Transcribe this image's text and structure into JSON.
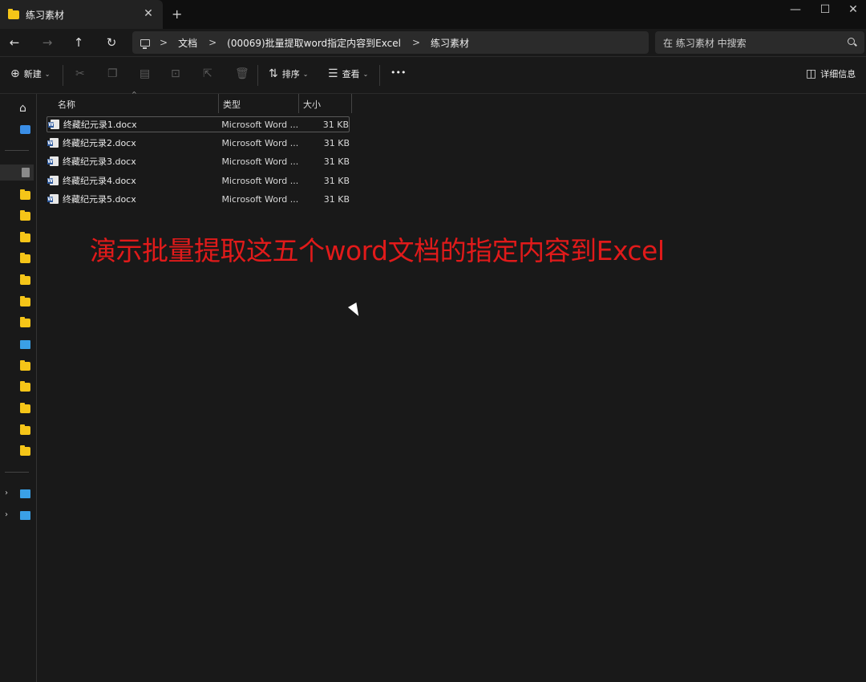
{
  "window": {
    "tab_title": "练习素材",
    "close_tab": "✕",
    "new_tab": "+",
    "minimize": "—",
    "maximize": "☐",
    "close": "✕"
  },
  "nav": {
    "back": "←",
    "forward": "→",
    "up": "↑",
    "refresh": "↻"
  },
  "breadcrumb": {
    "items": [
      "文档",
      "(00069)批量提取word指定内容到Excel",
      "练习素材"
    ],
    "sep": ">"
  },
  "search": {
    "placeholder": "在 练习素材 中搜索"
  },
  "toolbar": {
    "new_label": "新建",
    "sort_label": "排序",
    "view_label": "查看",
    "more": "•••",
    "details_label": "详细信息"
  },
  "columns": {
    "name": "名称",
    "type": "类型",
    "size": "大小"
  },
  "files": [
    {
      "name": "终藏纪元录1.docx",
      "type": "Microsoft Word ...",
      "size": "31 KB"
    },
    {
      "name": "终藏纪元录2.docx",
      "type": "Microsoft Word ...",
      "size": "31 KB"
    },
    {
      "name": "终藏纪元录3.docx",
      "type": "Microsoft Word ...",
      "size": "31 KB"
    },
    {
      "name": "终藏纪元录4.docx",
      "type": "Microsoft Word ...",
      "size": "31 KB"
    },
    {
      "name": "终藏纪元录5.docx",
      "type": "Microsoft Word ...",
      "size": "31 KB"
    }
  ],
  "overlay": {
    "caption": "演示批量提取这五个word文档的指定内容到Excel"
  },
  "colors": {
    "accent_folder": "#f5c518",
    "overlay_red": "#e11a1a",
    "background": "#191919"
  }
}
